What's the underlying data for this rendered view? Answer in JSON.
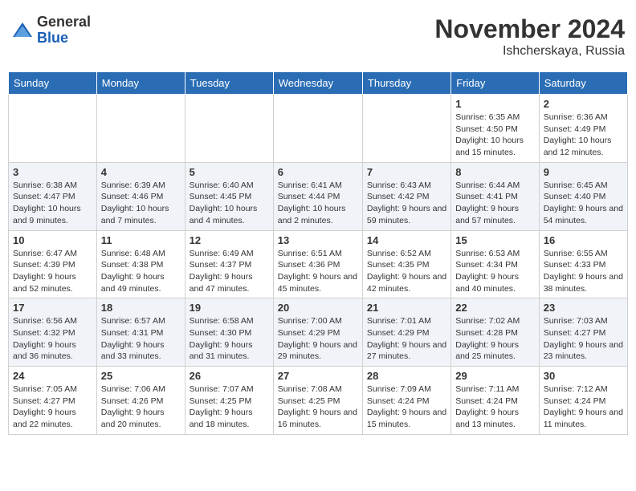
{
  "header": {
    "logo_general": "General",
    "logo_blue": "Blue",
    "month_title": "November 2024",
    "location": "Ishcherskaya, Russia"
  },
  "weekdays": [
    "Sunday",
    "Monday",
    "Tuesday",
    "Wednesday",
    "Thursday",
    "Friday",
    "Saturday"
  ],
  "weeks": [
    [
      {
        "day": "",
        "info": ""
      },
      {
        "day": "",
        "info": ""
      },
      {
        "day": "",
        "info": ""
      },
      {
        "day": "",
        "info": ""
      },
      {
        "day": "",
        "info": ""
      },
      {
        "day": "1",
        "info": "Sunrise: 6:35 AM\nSunset: 4:50 PM\nDaylight: 10 hours and 15 minutes."
      },
      {
        "day": "2",
        "info": "Sunrise: 6:36 AM\nSunset: 4:49 PM\nDaylight: 10 hours and 12 minutes."
      }
    ],
    [
      {
        "day": "3",
        "info": "Sunrise: 6:38 AM\nSunset: 4:47 PM\nDaylight: 10 hours and 9 minutes."
      },
      {
        "day": "4",
        "info": "Sunrise: 6:39 AM\nSunset: 4:46 PM\nDaylight: 10 hours and 7 minutes."
      },
      {
        "day": "5",
        "info": "Sunrise: 6:40 AM\nSunset: 4:45 PM\nDaylight: 10 hours and 4 minutes."
      },
      {
        "day": "6",
        "info": "Sunrise: 6:41 AM\nSunset: 4:44 PM\nDaylight: 10 hours and 2 minutes."
      },
      {
        "day": "7",
        "info": "Sunrise: 6:43 AM\nSunset: 4:42 PM\nDaylight: 9 hours and 59 minutes."
      },
      {
        "day": "8",
        "info": "Sunrise: 6:44 AM\nSunset: 4:41 PM\nDaylight: 9 hours and 57 minutes."
      },
      {
        "day": "9",
        "info": "Sunrise: 6:45 AM\nSunset: 4:40 PM\nDaylight: 9 hours and 54 minutes."
      }
    ],
    [
      {
        "day": "10",
        "info": "Sunrise: 6:47 AM\nSunset: 4:39 PM\nDaylight: 9 hours and 52 minutes."
      },
      {
        "day": "11",
        "info": "Sunrise: 6:48 AM\nSunset: 4:38 PM\nDaylight: 9 hours and 49 minutes."
      },
      {
        "day": "12",
        "info": "Sunrise: 6:49 AM\nSunset: 4:37 PM\nDaylight: 9 hours and 47 minutes."
      },
      {
        "day": "13",
        "info": "Sunrise: 6:51 AM\nSunset: 4:36 PM\nDaylight: 9 hours and 45 minutes."
      },
      {
        "day": "14",
        "info": "Sunrise: 6:52 AM\nSunset: 4:35 PM\nDaylight: 9 hours and 42 minutes."
      },
      {
        "day": "15",
        "info": "Sunrise: 6:53 AM\nSunset: 4:34 PM\nDaylight: 9 hours and 40 minutes."
      },
      {
        "day": "16",
        "info": "Sunrise: 6:55 AM\nSunset: 4:33 PM\nDaylight: 9 hours and 38 minutes."
      }
    ],
    [
      {
        "day": "17",
        "info": "Sunrise: 6:56 AM\nSunset: 4:32 PM\nDaylight: 9 hours and 36 minutes."
      },
      {
        "day": "18",
        "info": "Sunrise: 6:57 AM\nSunset: 4:31 PM\nDaylight: 9 hours and 33 minutes."
      },
      {
        "day": "19",
        "info": "Sunrise: 6:58 AM\nSunset: 4:30 PM\nDaylight: 9 hours and 31 minutes."
      },
      {
        "day": "20",
        "info": "Sunrise: 7:00 AM\nSunset: 4:29 PM\nDaylight: 9 hours and 29 minutes."
      },
      {
        "day": "21",
        "info": "Sunrise: 7:01 AM\nSunset: 4:29 PM\nDaylight: 9 hours and 27 minutes."
      },
      {
        "day": "22",
        "info": "Sunrise: 7:02 AM\nSunset: 4:28 PM\nDaylight: 9 hours and 25 minutes."
      },
      {
        "day": "23",
        "info": "Sunrise: 7:03 AM\nSunset: 4:27 PM\nDaylight: 9 hours and 23 minutes."
      }
    ],
    [
      {
        "day": "24",
        "info": "Sunrise: 7:05 AM\nSunset: 4:27 PM\nDaylight: 9 hours and 22 minutes."
      },
      {
        "day": "25",
        "info": "Sunrise: 7:06 AM\nSunset: 4:26 PM\nDaylight: 9 hours and 20 minutes."
      },
      {
        "day": "26",
        "info": "Sunrise: 7:07 AM\nSunset: 4:25 PM\nDaylight: 9 hours and 18 minutes."
      },
      {
        "day": "27",
        "info": "Sunrise: 7:08 AM\nSunset: 4:25 PM\nDaylight: 9 hours and 16 minutes."
      },
      {
        "day": "28",
        "info": "Sunrise: 7:09 AM\nSunset: 4:24 PM\nDaylight: 9 hours and 15 minutes."
      },
      {
        "day": "29",
        "info": "Sunrise: 7:11 AM\nSunset: 4:24 PM\nDaylight: 9 hours and 13 minutes."
      },
      {
        "day": "30",
        "info": "Sunrise: 7:12 AM\nSunset: 4:24 PM\nDaylight: 9 hours and 11 minutes."
      }
    ]
  ]
}
